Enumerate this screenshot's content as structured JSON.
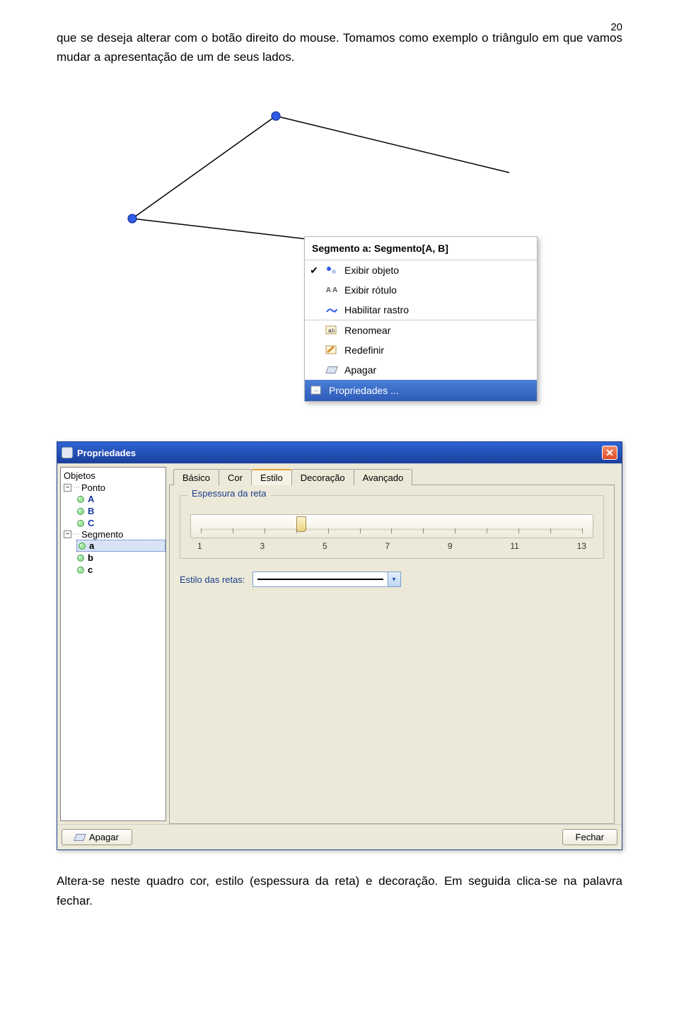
{
  "page_number": "20",
  "paragraph_top": "que se deseja alterar com o botão direito do mouse. Tomamos como exemplo o triângulo em que vamos mudar a apresentação de um de seus lados.",
  "context_menu": {
    "header": "Segmento a: Segmento[A, B]",
    "items": [
      {
        "label": "Exibir objeto",
        "checked": true
      },
      {
        "label": "Exibir rótulo",
        "checked": false
      },
      {
        "label": "Habilitar rastro",
        "checked": false
      }
    ],
    "items2": [
      {
        "label": "Renomear"
      },
      {
        "label": "Redefinir"
      },
      {
        "label": "Apagar"
      }
    ],
    "footer": "Propriedades ..."
  },
  "dialog": {
    "title": "Propriedades",
    "tree": {
      "header": "Objetos",
      "groups": [
        {
          "name": "Ponto",
          "items": [
            "A",
            "B",
            "C"
          ]
        },
        {
          "name": "Segmento",
          "items": [
            "a",
            "b",
            "c"
          ],
          "selected": "a"
        }
      ]
    },
    "tabs": [
      "Básico",
      "Cor",
      "Estilo",
      "Decoração",
      "Avançado"
    ],
    "active_tab": "Estilo",
    "fieldset_label": "Espessura da reta",
    "slider_labels": [
      "1",
      "3",
      "5",
      "7",
      "9",
      "11",
      "13"
    ],
    "line_style_label": "Estilo das retas:",
    "delete_btn": "Apagar",
    "close_btn": "Fechar"
  },
  "paragraph_bottom": "Altera-se neste quadro cor, estilo (espessura da reta) e decoração. Em seguida clica-se na palavra fechar."
}
